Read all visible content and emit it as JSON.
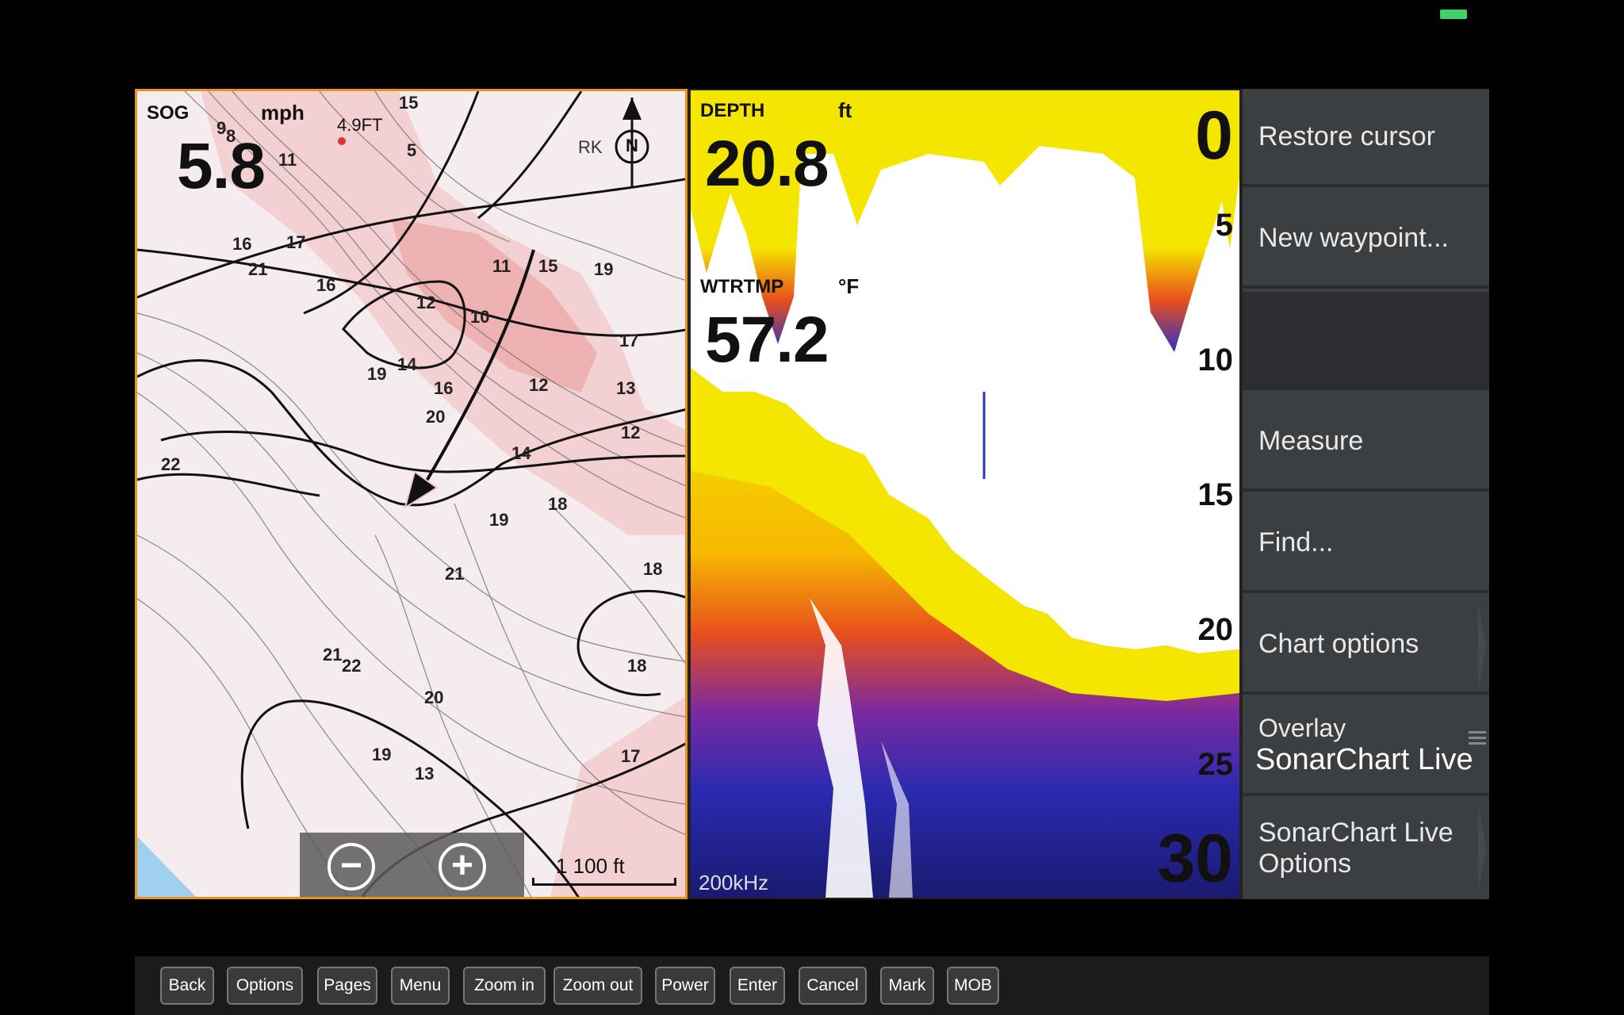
{
  "status": {
    "battery_color": "#3fd26a"
  },
  "chart": {
    "sog_label": "SOG",
    "sog_unit": "mph",
    "sog_value": "5.8",
    "marker_label": "4.9FT",
    "rk_label": "RK",
    "north_label": "N",
    "scale": "1 100 ft",
    "depth_labels": [
      "15",
      "9",
      "8",
      "11",
      "5",
      "16",
      "17",
      "21",
      "16",
      "12",
      "10",
      "11",
      "15",
      "19",
      "17",
      "14",
      "19",
      "16",
      "12",
      "13",
      "20",
      "12",
      "22",
      "14",
      "18",
      "19",
      "18",
      "21",
      "22",
      "21",
      "20",
      "18",
      "19",
      "17",
      "13"
    ]
  },
  "sonar": {
    "depth_label": "DEPTH",
    "depth_unit": "ft",
    "depth_value": "20.8",
    "wtrtmp_label": "WTRTMP",
    "wtrtmp_unit": "°F",
    "wtrtmp_value": "57.2",
    "frequency": "200kHz",
    "scale": [
      "0",
      "5",
      "10",
      "15",
      "20",
      "25",
      "30"
    ]
  },
  "menu": {
    "items": [
      "Restore cursor",
      "New waypoint...",
      "",
      "Measure",
      "Find...",
      "Chart options"
    ],
    "overlay_label": "Overlay",
    "overlay_value": "SonarChart Live",
    "last_line1": "SonarChart Live",
    "last_line2": "Options"
  },
  "buttons": [
    "Back",
    "Options",
    "Pages",
    "Menu",
    "Zoom in",
    "Zoom out",
    "Power",
    "Enter",
    "Cancel",
    "Mark",
    "MOB"
  ]
}
